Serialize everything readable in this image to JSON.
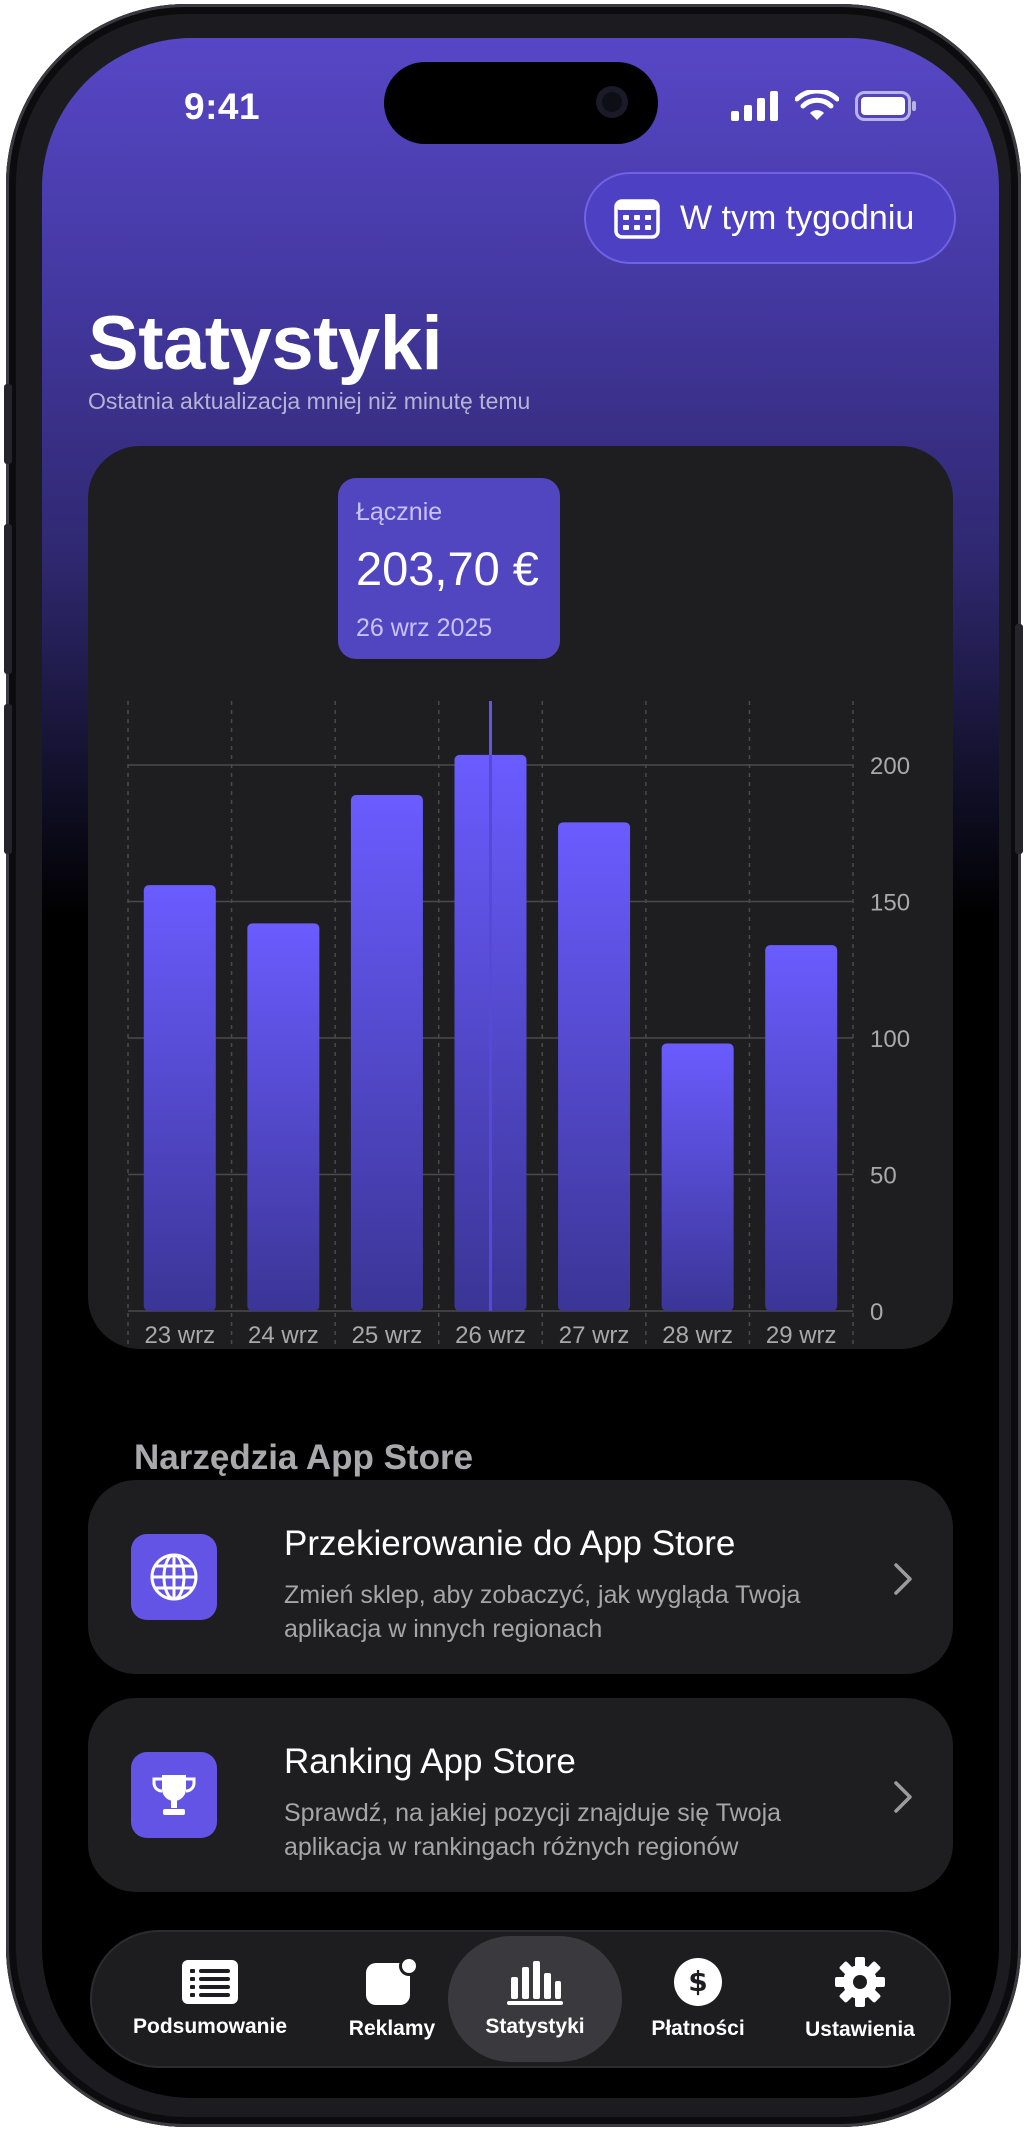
{
  "status_bar": {
    "time": "9:41"
  },
  "header": {
    "date_filter_label": "W tym tygodniu",
    "title": "Statystyki",
    "subtitle": "Ostatnia aktualizacja mniej niż minutę temu"
  },
  "tooltip": {
    "label": "Łącznie",
    "value": "203,70 €",
    "date": "26 wrz 2025"
  },
  "chart_data": {
    "type": "bar",
    "categories": [
      "23 wrz",
      "24 wrz",
      "25 wrz",
      "26 wrz",
      "27 wrz",
      "28 wrz",
      "29 wrz"
    ],
    "values": [
      156,
      142,
      189,
      203.7,
      179,
      98,
      134
    ],
    "selected_index": 3,
    "yticks": [
      0,
      50,
      100,
      150,
      200
    ],
    "ylim": [
      0,
      200
    ],
    "ylabel_position": "right",
    "grid": true,
    "colors": {
      "bar_top": "#6a5cff",
      "bar_bottom": "#3b3596",
      "grid": "#4a4a4e"
    }
  },
  "tools": {
    "section_title": "Narzędzia App Store",
    "items": [
      {
        "title": "Przekierowanie do App Store",
        "description": "Zmień sklep, aby zobaczyć, jak wygląda Twoja aplikacja w innych regionach",
        "icon": "globe-icon"
      },
      {
        "title": "Ranking App Store",
        "description": "Sprawdź, na jakiej pozycji znajduje się Twoja aplikacja w rankingach różnych regionów",
        "icon": "trophy-icon"
      }
    ]
  },
  "tabbar": {
    "active": "Statystyki",
    "items": [
      {
        "label": "Podsumowanie",
        "icon": "list-icon"
      },
      {
        "label": "Reklamy",
        "icon": "app-badge-icon"
      },
      {
        "label": "Statystyki",
        "icon": "bar-chart-icon"
      },
      {
        "label": "Płatności",
        "icon": "dollar-icon"
      },
      {
        "label": "Ustawienia",
        "icon": "gear-icon"
      }
    ]
  },
  "colors": {
    "accent": "#6354e6",
    "card_bg": "#1e1e20",
    "header_gradient_top": "#5747c6"
  }
}
